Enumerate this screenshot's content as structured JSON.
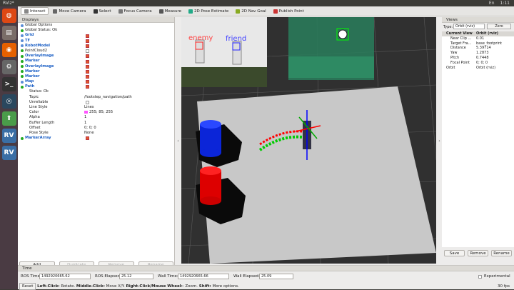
{
  "top_bar": {
    "title": "RViz*",
    "tray": [
      "En",
      "1:11"
    ]
  },
  "launcher": [
    {
      "name": "dash-icon",
      "color": "#dd4814",
      "glyph": "◍"
    },
    {
      "name": "files-icon",
      "color": "#7a6d68",
      "glyph": "▤"
    },
    {
      "name": "firefox-icon",
      "color": "#e66000",
      "glyph": "◉"
    },
    {
      "name": "settings-icon",
      "color": "#666",
      "glyph": "⚙"
    },
    {
      "name": "terminal-icon",
      "color": "#333",
      "glyph": ">_"
    },
    {
      "name": "steam-icon",
      "color": "#2a475e",
      "glyph": "◎"
    },
    {
      "name": "update-icon",
      "color": "#4a9c4a",
      "glyph": "⬆"
    },
    {
      "name": "rviz-icon",
      "color": "#3a6ea5",
      "glyph": "RV"
    },
    {
      "name": "rviz-icon-2",
      "color": "#3a6ea5",
      "glyph": "RV"
    }
  ],
  "toolbar": {
    "tools": [
      "Interact",
      "Move Camera",
      "Select",
      "Focus Camera",
      "Measure",
      "2D Pose Estimate",
      "2D Nav Goal",
      "Publish Point"
    ]
  },
  "displays": {
    "header": "Displays",
    "rows": [
      {
        "name": "Global Options",
        "value": "",
        "blue": false,
        "check": null,
        "ind": 1,
        "icon": "#5a8dd6"
      },
      {
        "name": "Global Status: Ok",
        "value": "",
        "blue": false,
        "check": null,
        "ind": 1,
        "icon": "#2a2"
      },
      {
        "name": "Grid",
        "value": "",
        "blue": true,
        "check": true,
        "ind": 1,
        "icon": "#5a8dd6"
      },
      {
        "name": "TF",
        "value": "",
        "blue": true,
        "check": true,
        "ind": 1,
        "icon": "#5a8dd6"
      },
      {
        "name": "RobotModel",
        "value": "",
        "blue": true,
        "check": true,
        "ind": 1,
        "icon": "#5a8dd6"
      },
      {
        "name": "PointCloud2",
        "value": "",
        "blue": false,
        "check": false,
        "ind": 1,
        "icon": "#2a2"
      },
      {
        "name": "OverlayImage",
        "value": "",
        "blue": true,
        "check": true,
        "ind": 1,
        "icon": "#2a2"
      },
      {
        "name": "Marker",
        "value": "",
        "blue": true,
        "check": true,
        "ind": 1,
        "icon": "#2a2"
      },
      {
        "name": "OverlayImage",
        "value": "",
        "blue": true,
        "check": true,
        "ind": 1,
        "icon": "#2a2"
      },
      {
        "name": "Marker",
        "value": "",
        "blue": true,
        "check": true,
        "ind": 1,
        "icon": "#2a2"
      },
      {
        "name": "Marker",
        "value": "",
        "blue": true,
        "check": true,
        "ind": 1,
        "icon": "#2a2"
      },
      {
        "name": "Map",
        "value": "",
        "blue": true,
        "check": true,
        "ind": 1,
        "icon": "#5a8dd6"
      },
      {
        "name": "Path",
        "value": "",
        "blue": true,
        "check": true,
        "ind": 1,
        "icon": "#2a2"
      },
      {
        "name": "Status: Ok",
        "value": "",
        "blue": false,
        "check": null,
        "ind": 2,
        "icon": ""
      },
      {
        "name": "Topic",
        "value": "/footstep_navigation/path",
        "blue": false,
        "check": null,
        "ind": 2,
        "icon": ""
      },
      {
        "name": "Unreliable",
        "value": "",
        "blue": false,
        "check": false,
        "ind": 2,
        "icon": ""
      },
      {
        "name": "Line Style",
        "value": "Lines",
        "blue": false,
        "check": null,
        "ind": 2,
        "icon": ""
      },
      {
        "name": "Color",
        "value": "255; 85; 255",
        "blue": false,
        "check": null,
        "ind": 2,
        "icon": "",
        "swatch": "#ff55ff"
      },
      {
        "name": "Alpha",
        "value": "1",
        "blue": false,
        "check": null,
        "ind": 2,
        "icon": ""
      },
      {
        "name": "Buffer Length",
        "value": "1",
        "blue": false,
        "check": null,
        "ind": 2,
        "icon": ""
      },
      {
        "name": "Offset",
        "value": "0; 0; 0",
        "blue": false,
        "check": null,
        "ind": 2,
        "icon": ""
      },
      {
        "name": "Pose Style",
        "value": "None",
        "blue": false,
        "check": null,
        "ind": 2,
        "icon": ""
      },
      {
        "name": "MarkerArray",
        "value": "",
        "blue": true,
        "check": true,
        "ind": 1,
        "icon": "#2a2"
      }
    ],
    "buttons": [
      "Add",
      "Duplicate",
      "Remove",
      "Rename"
    ]
  },
  "viewport": {
    "overlay_labels": [
      "enemy",
      "friend"
    ]
  },
  "views": {
    "header": "Views",
    "type_label": "Type:",
    "type_value": "Orbit (rviz)",
    "zero": "Zero",
    "rows": [
      {
        "name": "Current View",
        "value": "Orbit (rviz)",
        "hl": true
      },
      {
        "name": "Near Clip ...",
        "value": "0.01",
        "hl": false
      },
      {
        "name": "Target Fra...",
        "value": "base_footprint",
        "hl": false
      },
      {
        "name": "Distance",
        "value": "5.39714",
        "hl": false
      },
      {
        "name": "Yaw",
        "value": "1.2873",
        "hl": false
      },
      {
        "name": "Pitch",
        "value": "0.7448",
        "hl": false
      },
      {
        "name": "Focal Point",
        "value": "0; 0; 0",
        "hl": false
      },
      {
        "name": "Orbit",
        "value": "Orbit (rviz)",
        "hl": false
      }
    ],
    "buttons": [
      "Save",
      "Remove",
      "Rename"
    ]
  },
  "time": {
    "header": "Time",
    "ros_time_label": "ROS Time:",
    "ros_time": "1492920665.62",
    "ros_elapsed_label": "ROS Elapsed:",
    "ros_elapsed": "25.12",
    "wall_time_label": "Wall Time:",
    "wall_time": "1492920665.66",
    "wall_elapsed_label": "Wall Elapsed:",
    "wall_elapsed": "25.09",
    "experimental": "Experimental",
    "reset": "Reset",
    "help_bold1": "Left-Click:",
    "help1": " Rotate. ",
    "help_bold2": "Middle-Click:",
    "help2": " Move X/Y. ",
    "help_bold3": "Right-Click/Mouse Wheel:",
    "help3": ": Zoom. ",
    "help_bold4": "Shift:",
    "help4": " More options.",
    "fps": "30 fps"
  }
}
